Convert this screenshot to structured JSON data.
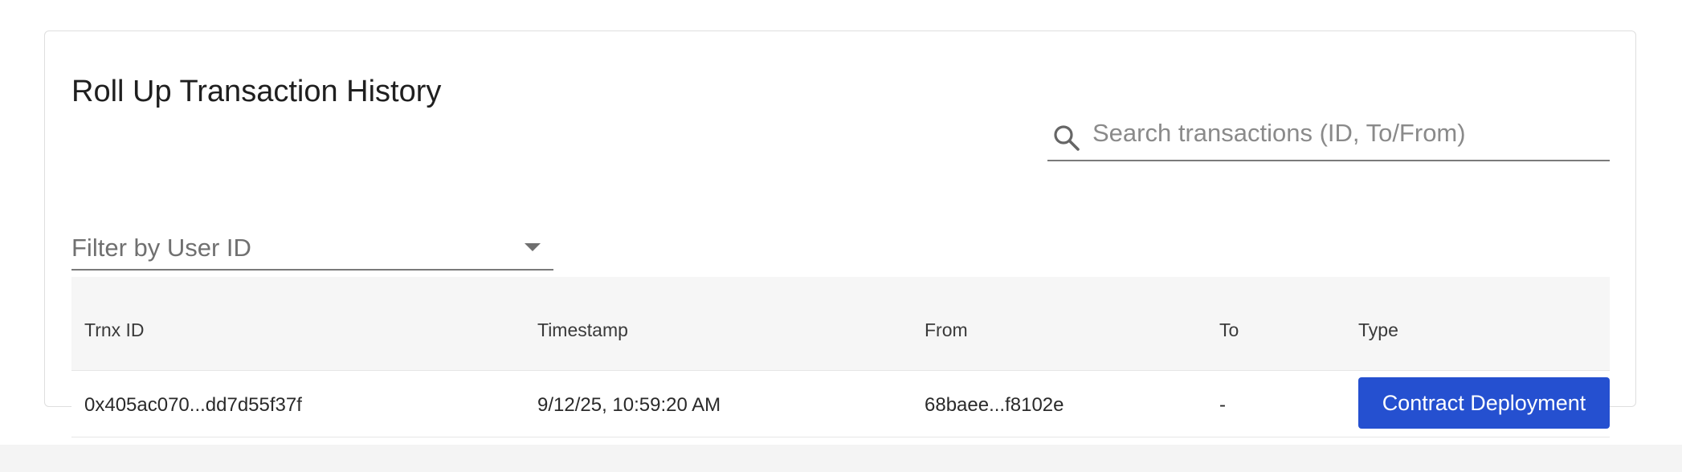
{
  "card": {
    "title": "Roll Up Transaction History"
  },
  "search": {
    "placeholder": "Search transactions (ID, To/From)",
    "value": "",
    "icon": "search-icon"
  },
  "filter": {
    "label": "Filter by User ID",
    "icon": "caret-down-icon"
  },
  "table": {
    "columns": [
      "Trnx ID",
      "Timestamp",
      "From",
      "To",
      "Type"
    ],
    "rows": [
      {
        "trnx_id": "0x405ac070...dd7d55f37f",
        "timestamp": "9/12/25, 10:59:20 AM",
        "from": "68baee...f8102e",
        "to": "-",
        "type": "Contract Deployment"
      }
    ]
  },
  "colors": {
    "type_badge": "#2550d0",
    "header_bg": "#f6f6f6"
  }
}
